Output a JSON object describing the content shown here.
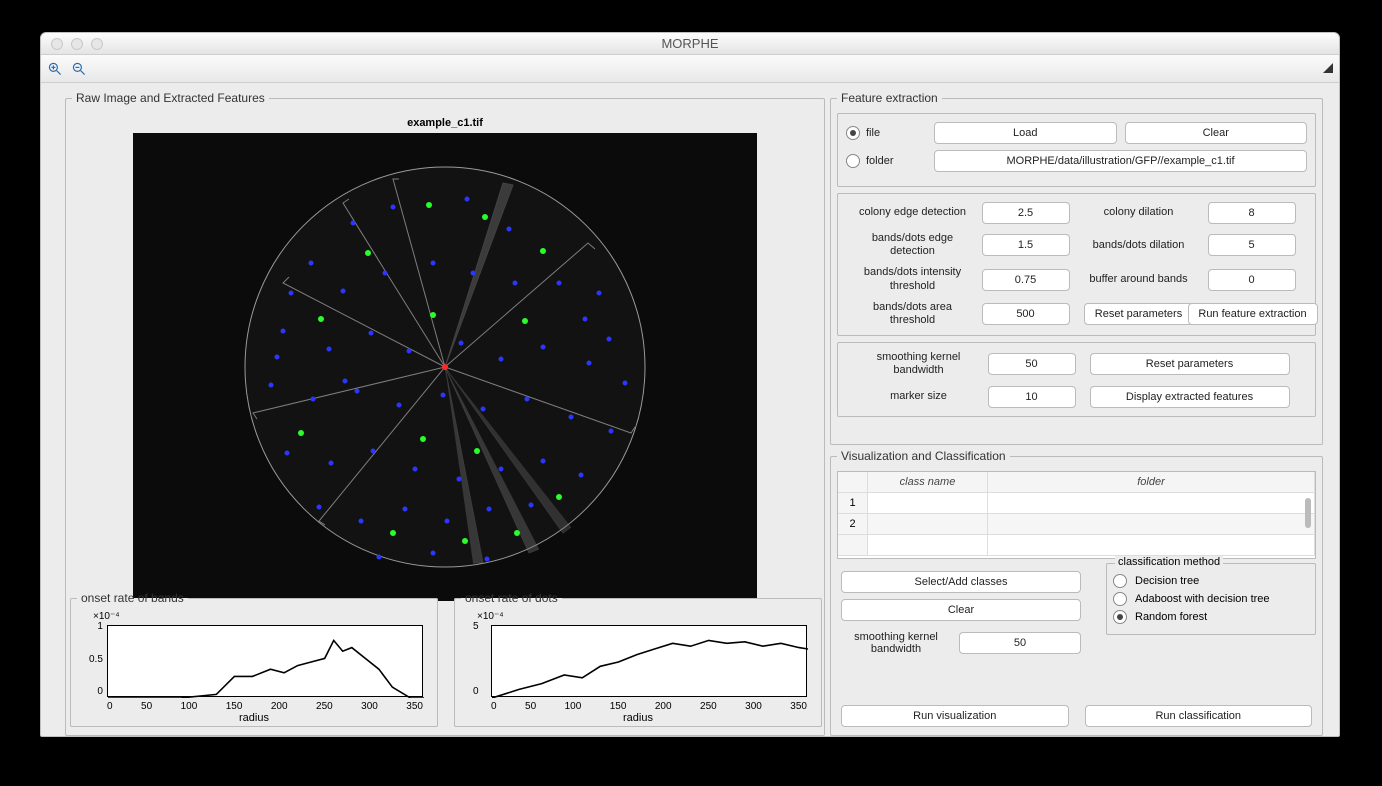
{
  "window": {
    "title": "MORPHE"
  },
  "toolbar": {
    "zoom_in": "zoom-in",
    "zoom_out": "zoom-out"
  },
  "panels": {
    "raw": {
      "legend": "Raw Image and Extracted Features",
      "image_title": "example_c1.tif"
    },
    "feat": {
      "legend": "Feature extraction"
    },
    "viz": {
      "legend": "Visualization and Classification"
    }
  },
  "feature": {
    "file_label": "file",
    "folder_label": "folder",
    "load": "Load",
    "clear": "Clear",
    "path": "MORPHE/data/illustration/GFP//example_c1.tif",
    "params": {
      "colony_edge_label": "colony edge detection",
      "colony_edge": "2.5",
      "colony_dilation_label": "colony dilation",
      "colony_dilation": "8",
      "bd_edge_label": "bands/dots edge detection",
      "bd_edge": "1.5",
      "bd_dilation_label": "bands/dots dilation",
      "bd_dilation": "5",
      "bd_intensity_label": "bands/dots intensity threshold",
      "bd_intensity": "0.75",
      "buffer_label": "buffer around bands",
      "buffer": "0",
      "bd_area_label": "bands/dots area threshold",
      "bd_area": "500",
      "reset": "Reset parameters",
      "run": "Run feature extraction"
    },
    "display": {
      "smoothing_label": "smoothing kernel bandwidth",
      "smoothing": "50",
      "marker_label": "marker size",
      "marker": "10",
      "reset": "Reset parameters",
      "show": "Display extracted features"
    }
  },
  "viz": {
    "table": {
      "col_name": "class name",
      "col_folder": "folder",
      "rows": [
        "1",
        "2"
      ]
    },
    "select": "Select/Add classes",
    "clear": "Clear",
    "smoothing_label": "smoothing kernel bandwidth",
    "smoothing": "50",
    "run_viz": "Run visualization",
    "run_cls": "Run classification",
    "cls_method_legend": "classification method",
    "methods": {
      "dt": "Decision tree",
      "ada": "Adaboost with decision tree",
      "rf": "Random forest"
    }
  },
  "chart_data": [
    {
      "type": "line",
      "title": "onset rate of bands",
      "xlabel": "radius",
      "ylabel": "",
      "exp": "×10⁻⁴",
      "xlim": [
        0,
        350
      ],
      "ylim": [
        0,
        1
      ],
      "xticks": [
        0,
        50,
        100,
        150,
        200,
        250,
        300,
        350
      ],
      "yticks": [
        0,
        0.5,
        1
      ],
      "x": [
        0,
        40,
        80,
        120,
        140,
        160,
        180,
        195,
        210,
        225,
        240,
        250,
        260,
        270,
        285,
        300,
        315,
        335,
        350
      ],
      "values": [
        0,
        0,
        0,
        0.05,
        0.3,
        0.3,
        0.4,
        0.35,
        0.45,
        0.5,
        0.55,
        0.8,
        0.65,
        0.7,
        0.55,
        0.4,
        0.15,
        0.0,
        0.0
      ]
    },
    {
      "type": "line",
      "title": "onset rate of dots",
      "xlabel": "radius",
      "ylabel": "",
      "exp": "×10⁻⁴",
      "xlim": [
        0,
        350
      ],
      "ylim": [
        0,
        5
      ],
      "xticks": [
        0,
        50,
        100,
        150,
        200,
        250,
        300,
        350
      ],
      "yticks": [
        0,
        5
      ],
      "x": [
        0,
        30,
        55,
        80,
        100,
        120,
        140,
        160,
        180,
        200,
        220,
        240,
        260,
        280,
        300,
        320,
        340,
        350
      ],
      "values": [
        0,
        0.6,
        1.0,
        1.6,
        1.4,
        2.2,
        2.5,
        3.0,
        3.4,
        3.8,
        3.6,
        4.0,
        3.8,
        3.9,
        3.6,
        3.8,
        3.5,
        3.4
      ]
    }
  ]
}
